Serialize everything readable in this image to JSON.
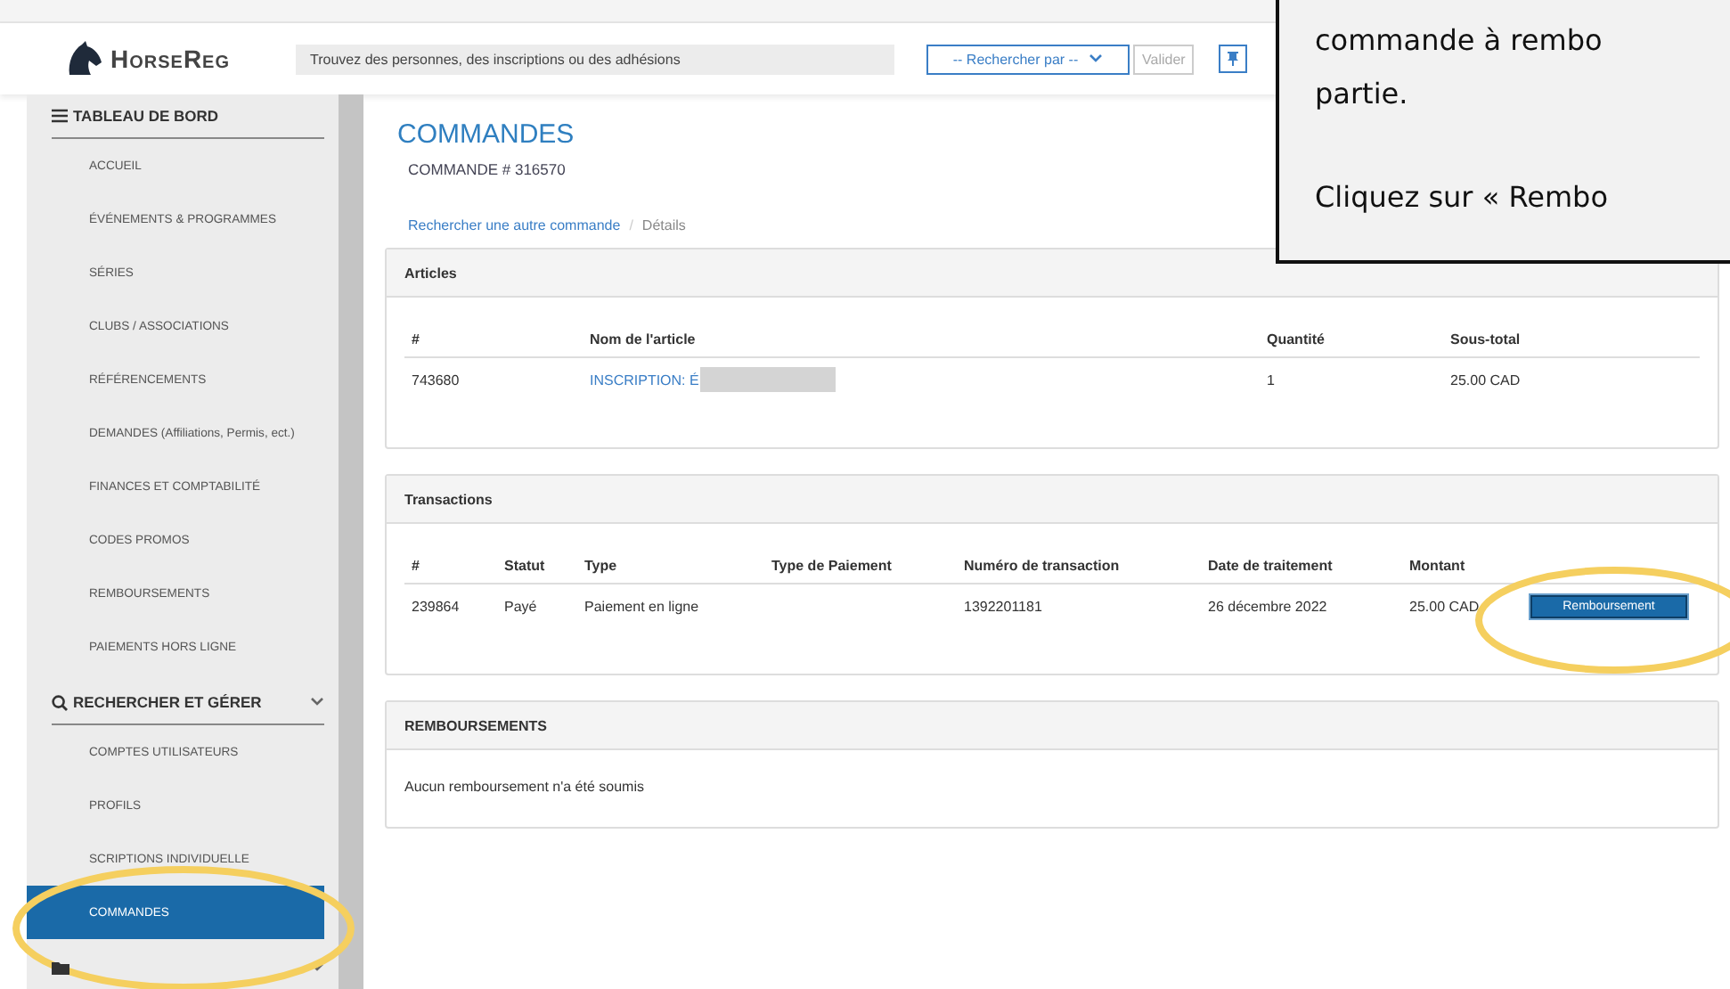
{
  "header": {
    "logo": "HorseReg",
    "search": {
      "placeholder": "Trouvez des personnes, des inscriptions ou des adhésions"
    },
    "search_by": "-- Rechercher par --",
    "submit": "Valider"
  },
  "sidebar": {
    "sections": [
      {
        "title": "TABLEAU DE BORD",
        "kind": "menu",
        "items": [
          {
            "label": "ACCUEIL",
            "selected": false
          },
          {
            "label": "ÉVÉNEMENTS & PROGRAMMES",
            "selected": false
          },
          {
            "label": "SÉRIES",
            "selected": false
          },
          {
            "label": "CLUBS / ASSOCIATIONS",
            "selected": false
          },
          {
            "label": "RÉFÉRENCEMENTS",
            "selected": false
          },
          {
            "label": "DEMANDES (Affiliations, Permis, ect.)",
            "selected": false
          },
          {
            "label": "FINANCES ET COMPTABILITÉ",
            "selected": false
          },
          {
            "label": "CODES PROMOS",
            "selected": false
          },
          {
            "label": "REMBOURSEMENTS",
            "selected": false
          },
          {
            "label": "PAIEMENTS HORS LIGNE",
            "selected": false
          }
        ]
      },
      {
        "title": "RECHERCHER ET GÉRER",
        "kind": "search",
        "items": [
          {
            "label": "COMPTES UTILISATEURS",
            "selected": false
          },
          {
            "label": "PROFILS",
            "selected": false
          },
          {
            "label": "SCRIPTIONS INDIVIDUELLE",
            "selected": false
          },
          {
            "label": "COMMANDES",
            "selected": true
          }
        ]
      },
      {
        "kind": "folder"
      }
    ]
  },
  "page": {
    "title": "COMMANDES",
    "subtitle": "COMMANDE # 316570",
    "breadcrumb": {
      "items": [
        "Rechercher une autre commande",
        "Détails"
      ],
      "separator": "/"
    }
  },
  "articles": {
    "title": "Articles",
    "columns": [
      "#",
      "Nom de l'article",
      "Quantité",
      "Sous-total"
    ],
    "rows": [
      [
        "743680",
        "INSCRIPTION: É",
        "1",
        "25.00 CAD"
      ]
    ]
  },
  "transactions": {
    "title": "Transactions",
    "columns": [
      "#",
      "Statut",
      "Type",
      "Type de Paiement",
      "Numéro de transaction",
      "Date de traitement",
      "Montant"
    ],
    "rows": [
      {
        "cells": [
          "239864",
          "Payé",
          "Paiement en ligne",
          "",
          "1392201181",
          "26 décembre 2022",
          "25.00 CAD"
        ],
        "action": "Remboursement"
      }
    ]
  },
  "refunds": {
    "title": "REMBOURSEMENTS",
    "message": "Aucun remboursement n'a été soumis"
  },
  "callout": {
    "lines": [
      "commande à rembo",
      "partie.",
      "Cliquez sur « Rembo"
    ]
  }
}
